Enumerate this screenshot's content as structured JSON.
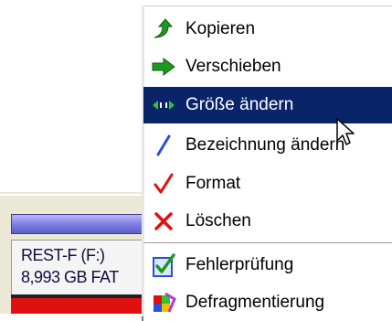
{
  "background_view": {
    "partition_name": "REST-F (F:)",
    "partition_size": "8,993 GB  FAT"
  },
  "context_menu": {
    "items": [
      {
        "label": "Kopieren",
        "icon": "copy-arrow-icon"
      },
      {
        "label": "Verschieben",
        "icon": "move-arrow-icon"
      },
      {
        "label": "Größe ändern",
        "icon": "resize-arrows-icon",
        "selected": true
      },
      {
        "label": "Bezeichnung ändern",
        "icon": "pen-icon"
      },
      {
        "label": "Format",
        "icon": "checkmark-icon"
      },
      {
        "label": "Löschen",
        "icon": "delete-x-icon"
      },
      {
        "label": "Fehlerprüfung",
        "icon": "check-box-icon"
      },
      {
        "label": "Defragmentierung",
        "icon": "defrag-icon"
      }
    ]
  },
  "colors": {
    "selection": "#0a246a",
    "green_icon": "#1d9a1d",
    "red_icon": "#e01010",
    "disk_bar": "#7b7be0"
  }
}
